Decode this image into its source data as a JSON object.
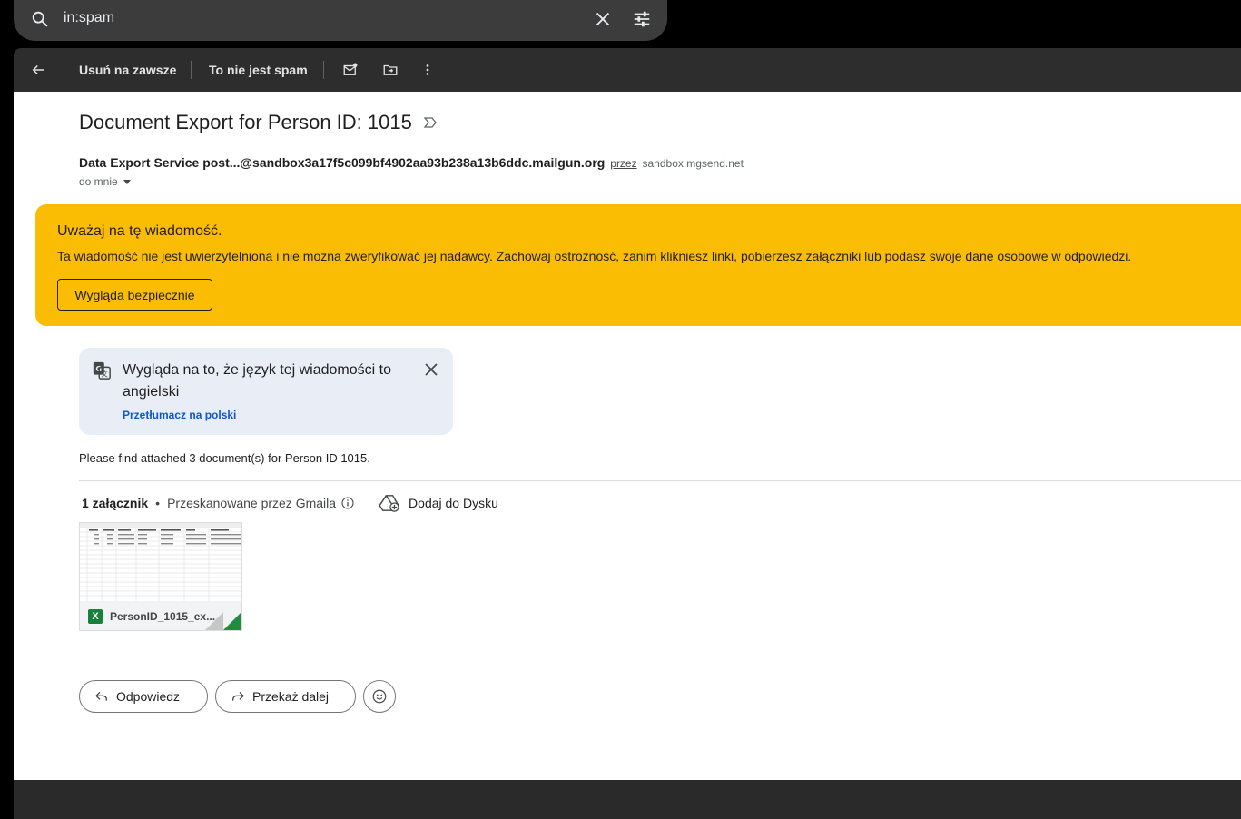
{
  "search": {
    "query": "in:spam"
  },
  "toolbar": {
    "delete_forever": "Usuń na zawsze",
    "not_spam": "To nie jest spam"
  },
  "email": {
    "subject": "Document Export for Person ID: 1015",
    "sender_name": "Data Export Service",
    "sender_email": "post...@sandbox3a17f5c099bf4902aa93b238a13b6ddc.mailgun.org",
    "via_label": "przez",
    "via_domain": "sandbox.mgsend.net",
    "to_me": "do mnie",
    "body": "Please find attached 3 document(s) for Person ID 1015."
  },
  "warning": {
    "title": "Uważaj na tę wiadomość.",
    "body": "Ta wiadomość nie jest uwierzytelniona i nie można zweryfikować jej nadawcy. Zachowaj ostrożność, zanim klikniesz linki, pobierzesz załączniki lub podasz swoje dane osobowe w odpowiedzi.",
    "button": "Wygląda bezpiecznie"
  },
  "translate": {
    "message": "Wygląda na to, że język tej wiadomości to angielski",
    "link": "Przetłumacz na polski"
  },
  "attachments": {
    "count_label": "1 załącznik",
    "scanned_label": "Przeskanowane przez Gmaila",
    "add_to_drive": "Dodaj do Dysku",
    "file_name": "PersonID_1015_ex...",
    "file_type_badge": "X"
  },
  "actions": {
    "reply": "Odpowiedz",
    "forward": "Przekaż dalej"
  },
  "colors": {
    "warning_bg": "#fbbc04",
    "link": "#0b57d0",
    "excel_green": "#188038"
  }
}
